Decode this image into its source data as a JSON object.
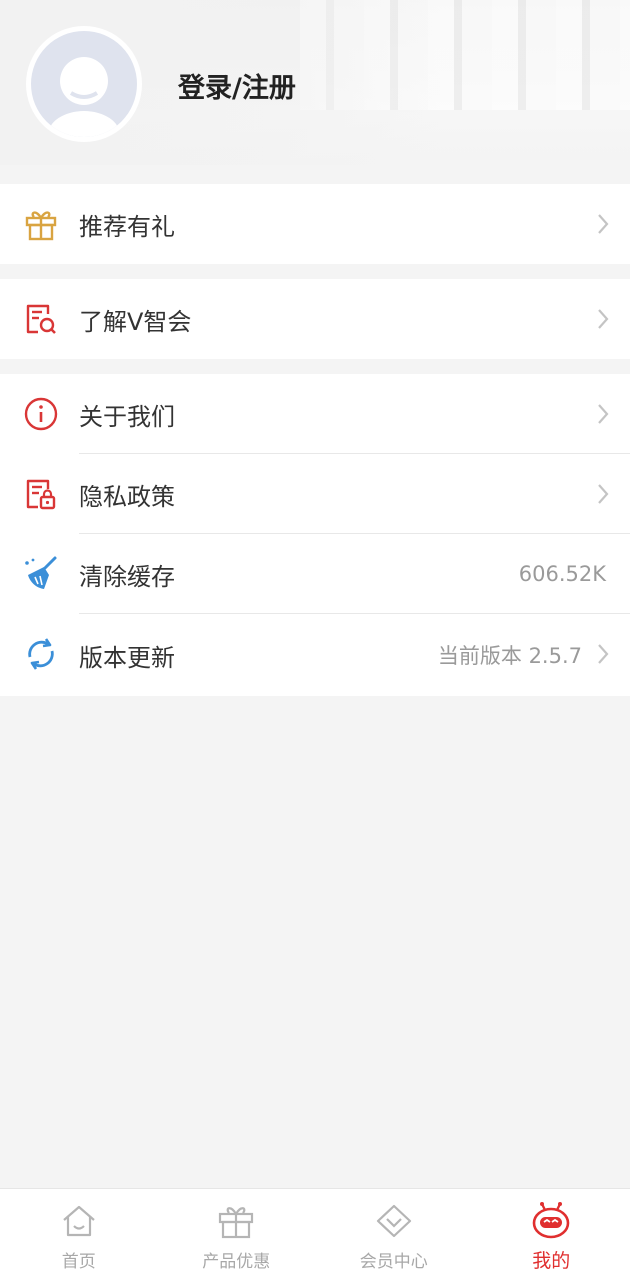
{
  "header": {
    "login_label": "登录/注册"
  },
  "menu": {
    "referral": {
      "label": "推荐有礼",
      "icon": "gift-icon"
    },
    "about_v": {
      "label": "了解V智会",
      "icon": "document-search-icon"
    },
    "about_us": {
      "label": "关于我们",
      "icon": "info-icon"
    },
    "privacy": {
      "label": "隐私政策",
      "icon": "document-lock-icon"
    },
    "clear_cache": {
      "label": "清除缓存",
      "value": "606.52K",
      "icon": "broom-icon"
    },
    "update": {
      "label": "版本更新",
      "value": "当前版本 2.5.7",
      "icon": "refresh-icon"
    }
  },
  "tabbar": {
    "tabs": [
      {
        "label": "首页",
        "icon": "home-icon",
        "active": false
      },
      {
        "label": "产品优惠",
        "icon": "gift-icon",
        "active": false
      },
      {
        "label": "会员中心",
        "icon": "diamond-icon",
        "active": false
      },
      {
        "label": "我的",
        "icon": "robot-face-icon",
        "active": true
      }
    ]
  },
  "colors": {
    "accent_red": "#e02f2f",
    "gold": "#d9a441",
    "blue": "#3b8fd8"
  }
}
